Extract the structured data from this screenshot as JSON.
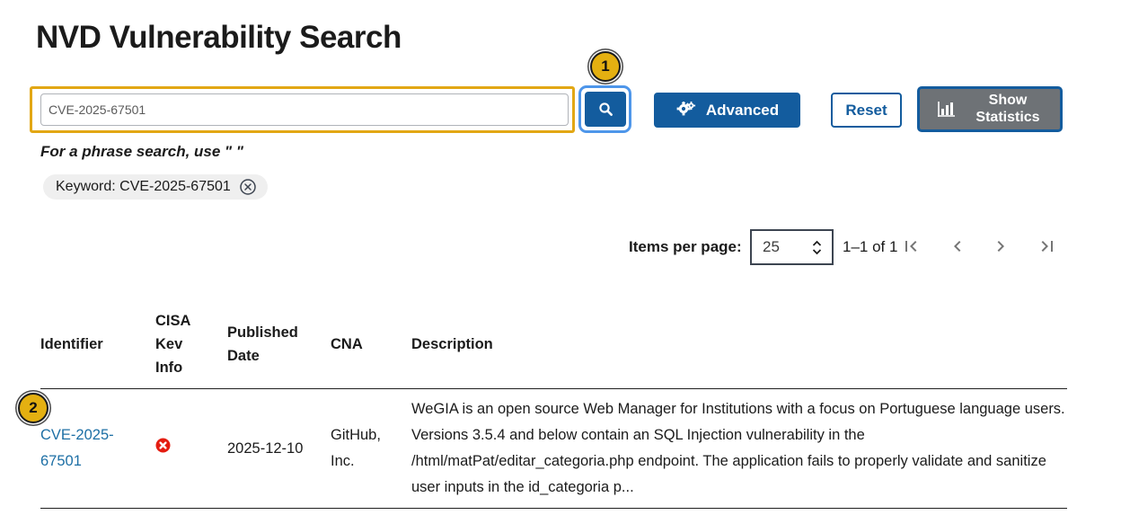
{
  "page": {
    "title": "NVD Vulnerability Search"
  },
  "colors": {
    "primary_blue": "#135c9e",
    "link_blue": "#1d6fa5",
    "stats_gray": "#6e7276",
    "annotation_gold": "#e4b011",
    "annotation_blue_ring": "#4e96ea",
    "kev_red": "#e41d11"
  },
  "search": {
    "input_value": "CVE-2025-67501",
    "phrase_hint": "For a phrase search, use \" \"",
    "advanced_label": "Advanced",
    "reset_label": "Reset",
    "stats_label": "Show Statistics",
    "keyword_chip": "Keyword: CVE-2025-67501"
  },
  "annotations": {
    "marker1": "1",
    "marker2": "2"
  },
  "icons": {
    "search": "magnifier",
    "advanced": "gears",
    "stats": "bar-chart",
    "chip_remove": "x-circle-outline",
    "select_spinner": "up-down-chevrons",
    "pagination": [
      "first-page",
      "chevron-left",
      "chevron-right",
      "last-page"
    ],
    "cisa_kev_negative": "red-x-circle"
  },
  "pagination": {
    "items_per_page_label": "Items per page:",
    "items_per_page_value": "25",
    "range_text": "1–1 of 1"
  },
  "table": {
    "headers": [
      "Identifier",
      "CISA Kev Info",
      "Published Date",
      "CNA",
      "Description"
    ],
    "rows": [
      {
        "identifier": "CVE-2025-67501",
        "cisa_kev_status": "not-in-kev",
        "published_date": "2025-12-10",
        "cna": "GitHub, Inc.",
        "description": "WeGIA is an open source Web Manager for Institutions with a focus on Portuguese language users. Versions 3.5.4 and below contain an SQL Injection vulnerability in the /html/matPat/editar_categoria.php endpoint. The application fails to properly validate and sanitize user inputs in the id_categoria p..."
      }
    ]
  }
}
